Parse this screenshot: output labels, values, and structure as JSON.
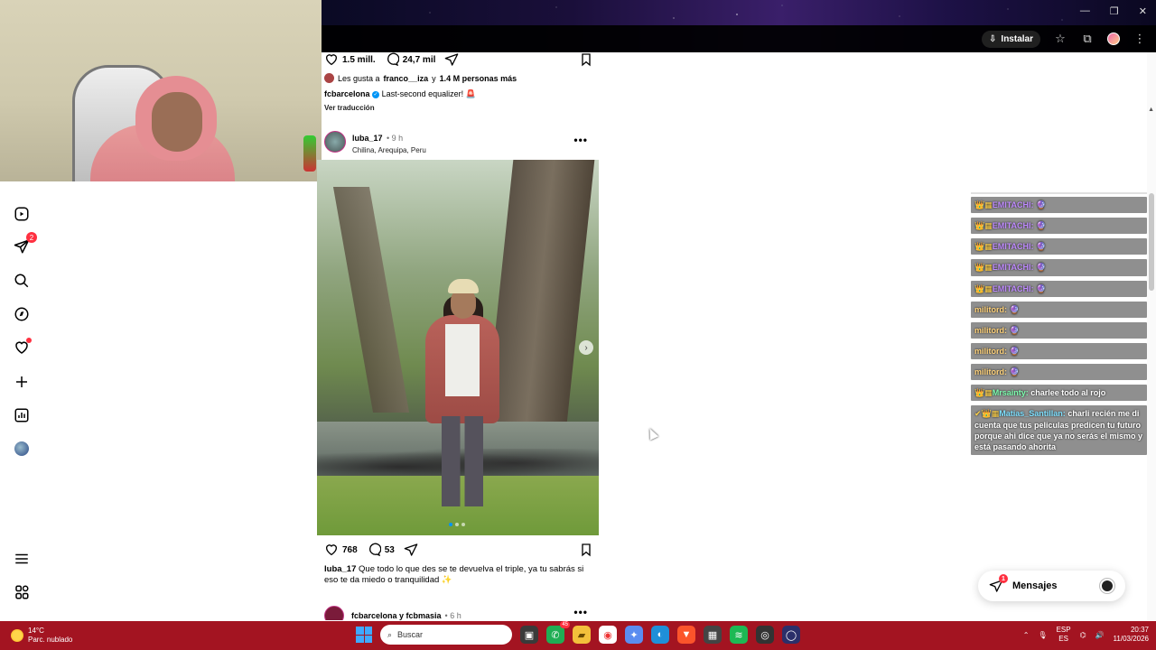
{
  "browser": {
    "install_label": "Instalar",
    "window_controls": [
      "—",
      "❐",
      "✕"
    ]
  },
  "nav": {
    "items": [
      {
        "name": "reels",
        "icon": "reels-icon"
      },
      {
        "name": "messages",
        "icon": "send-icon",
        "badge": "2"
      },
      {
        "name": "search",
        "icon": "search-icon"
      },
      {
        "name": "explore",
        "icon": "compass-icon"
      },
      {
        "name": "notifications",
        "icon": "heart-icon"
      },
      {
        "name": "create",
        "icon": "plus-icon"
      },
      {
        "name": "dashboard",
        "icon": "chart-icon"
      },
      {
        "name": "profile",
        "icon": "avatar-icon"
      }
    ],
    "bottom": [
      {
        "name": "more",
        "icon": "menu-icon"
      },
      {
        "name": "also-from-meta",
        "icon": "apps-icon"
      }
    ]
  },
  "prev_post": {
    "likes": "1.5 mill.",
    "comments": "24,7 mil",
    "liked_by_prefix": "Les gusta a",
    "liked_by_user": "franco__iza",
    "liked_by_joiner": "y",
    "liked_by_others": "1.4 M personas más",
    "caption_user": "fcbarcelona",
    "caption_text": "Last-second equalizer! 🚨",
    "see_translation": "Ver traducción"
  },
  "post": {
    "username": "luba_17",
    "time": "• 9 h",
    "location": "Chilina, Arequipa, Peru",
    "more": "•••",
    "likes": "768",
    "comments": "53",
    "caption_user": "luba_17",
    "caption_text": "Que todo lo que des se te devuelva el triple, ya tu sabrás si eso te da miedo o tranquilidad ✨"
  },
  "next_post": {
    "users": "fcbarcelona y fcbmasia",
    "time": "• 6 h",
    "more": "•••"
  },
  "chat": {
    "messages": [
      {
        "user": "EMITACHI:",
        "type": "emi",
        "text": "🔮",
        "icon": "👑▦"
      },
      {
        "user": "EMITACHI:",
        "type": "emi",
        "text": "🔮",
        "icon": "👑▦"
      },
      {
        "user": "EMITACHI:",
        "type": "emi",
        "text": "🔮",
        "icon": "👑▦"
      },
      {
        "user": "EMITACHI:",
        "type": "emi",
        "text": "🔮",
        "icon": "👑▦"
      },
      {
        "user": "EMITACHI:",
        "type": "emi",
        "text": "🔮",
        "icon": "👑▦"
      },
      {
        "user": "militord:",
        "type": "mil",
        "text": "🔮",
        "icon": ""
      },
      {
        "user": "militord:",
        "type": "mil",
        "text": "🔮",
        "icon": ""
      },
      {
        "user": "militord:",
        "type": "mil",
        "text": "🔮",
        "icon": ""
      },
      {
        "user": "militord:",
        "type": "mil",
        "text": "🔮",
        "icon": ""
      },
      {
        "user": "Mrsainty:",
        "type": "mrs",
        "text": "charlee todo al rojo",
        "icon": "👑▦"
      },
      {
        "user": "Matias_Santillan:",
        "type": "mat",
        "text": "charli recién me di cuenta que tus peliculas predicen tu futuro porque ahi dice que ya no serás el mismo y está pasando ahorita",
        "icon": "✔👑▦"
      }
    ]
  },
  "messages_pill": {
    "label": "Mensajes",
    "badge": "1"
  },
  "taskbar": {
    "temp": "14°C",
    "weather": "Parc. nublado",
    "search_placeholder": "Buscar",
    "whatsapp_badge": "45",
    "lang_top": "ESP",
    "lang_bottom": "ES",
    "time": "20:37",
    "date": "11/03/2026"
  },
  "colors": {
    "taskbar": "#a31421",
    "instagram_badge": "#ff3040",
    "verified": "#0095f6"
  }
}
